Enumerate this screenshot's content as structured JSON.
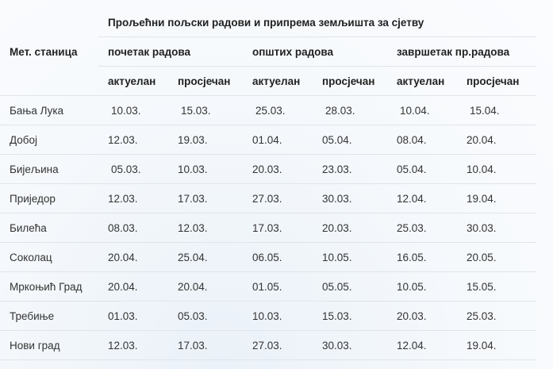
{
  "table": {
    "station_header": "Мет. станица",
    "group_title": "Прољећни пољски радови и припрема земљишта за сјетву",
    "phases": [
      "почетак радова",
      "општих радова",
      "завршетак пр.радова"
    ],
    "subheaders": [
      "актуелан",
      "просјечан",
      "актуелан",
      "просјечан",
      "актуелан",
      "просјечан"
    ],
    "rows": [
      {
        "station": "Бања Лука",
        "values": [
          "10.03.",
          "15.03.",
          "25.03.",
          "28.03.",
          "10.04.",
          "15.04."
        ]
      },
      {
        "station": "Добој",
        "values": [
          "12.03.",
          "19.03.",
          "01.04.",
          "05.04.",
          "08.04.",
          "20.04."
        ]
      },
      {
        "station": "Бијељина",
        "values": [
          "05.03.",
          "10.03.",
          "20.03.",
          "23.03.",
          "05.04.",
          "10.04."
        ]
      },
      {
        "station": "Приједор",
        "values": [
          "12.03.",
          "17.03.",
          "27.03.",
          "30.03.",
          "12.04.",
          "19.04."
        ]
      },
      {
        "station": "Билећа",
        "values": [
          "08.03.",
          "12.03.",
          "17.03.",
          "20.03.",
          "25.03.",
          "30.03."
        ]
      },
      {
        "station": "Соколац",
        "values": [
          "20.04.",
          "25.04.",
          "06.05.",
          "10.05.",
          "16.05.",
          "20.05."
        ]
      },
      {
        "station": "Мркоњић Град",
        "values": [
          "20.04.",
          "20.04.",
          "01.05.",
          "05.05.",
          "10.05.",
          "15.05."
        ]
      },
      {
        "station": "Требиње",
        "values": [
          "01.03.",
          "05.03.",
          "10.03.",
          "15.03.",
          "20.03.",
          "25.03."
        ]
      },
      {
        "station": "Нови град",
        "values": [
          "12.03.",
          "17.03.",
          "27.03.",
          "30.03.",
          "12.04.",
          "19.04."
        ]
      }
    ]
  }
}
